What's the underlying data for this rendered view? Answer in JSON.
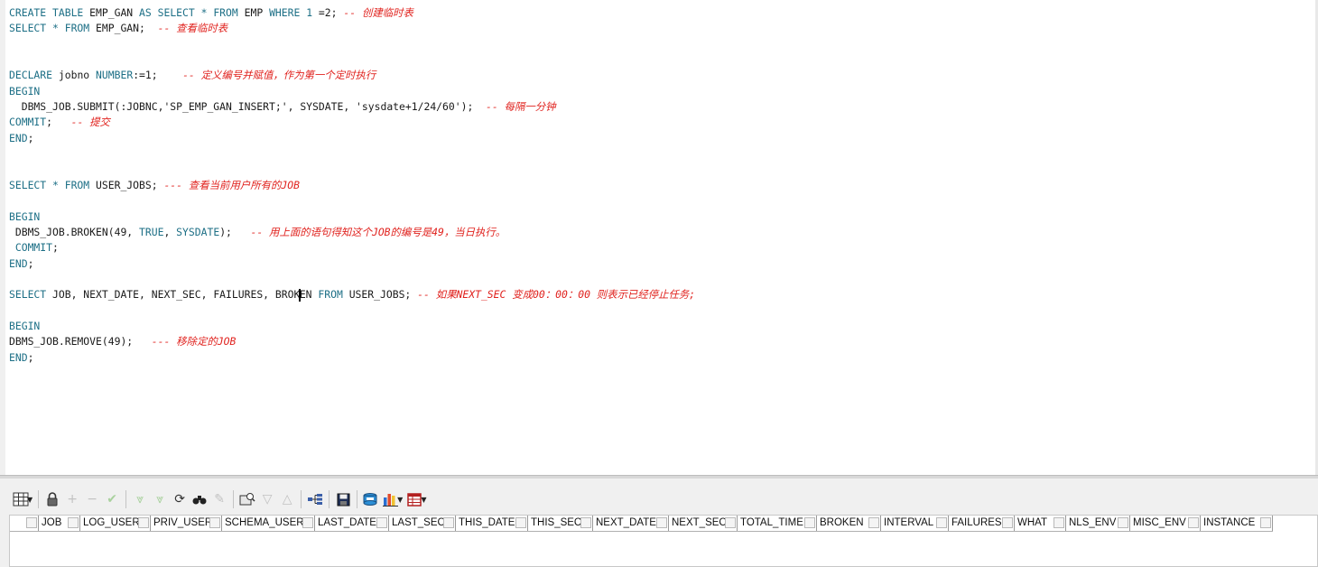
{
  "editor": {
    "lines": [
      {
        "segments": [
          {
            "t": "kw",
            "v": "CREATE TABLE "
          },
          {
            "t": "",
            "v": "EMP_GAN "
          },
          {
            "t": "kw",
            "v": "AS SELECT * FROM "
          },
          {
            "t": "",
            "v": "EMP "
          },
          {
            "t": "kw",
            "v": "WHERE "
          },
          {
            "t": "num",
            "v": "1"
          },
          {
            "t": "",
            "v": " =2; "
          },
          {
            "t": "cm",
            "v": "-- 创建临时表"
          }
        ]
      },
      {
        "segments": [
          {
            "t": "kw",
            "v": "SELECT * FROM "
          },
          {
            "t": "",
            "v": "EMP_GAN;  "
          },
          {
            "t": "cm",
            "v": "-- 查看临时表"
          }
        ]
      },
      {
        "segments": []
      },
      {
        "segments": []
      },
      {
        "segments": [
          {
            "t": "kw",
            "v": "DECLARE "
          },
          {
            "t": "",
            "v": "jobno "
          },
          {
            "t": "kw",
            "v": "NUMBER"
          },
          {
            "t": "",
            "v": ":=1;    "
          },
          {
            "t": "cm",
            "v": "-- 定义编号并赋值，作为第一个定时执行"
          }
        ]
      },
      {
        "segments": [
          {
            "t": "kw",
            "v": "BEGIN"
          }
        ]
      },
      {
        "segments": [
          {
            "t": "",
            "v": "  DBMS_JOB.SUBMIT(:JOBNC,'SP_EMP_GAN_INSERT;', SYSDATE, 'sysdate+1/24/60');  "
          },
          {
            "t": "cm",
            "v": "-- 每隔一分钟"
          }
        ]
      },
      {
        "segments": [
          {
            "t": "kw",
            "v": "COMMIT"
          },
          {
            "t": "",
            "v": ";   "
          },
          {
            "t": "cm",
            "v": "-- 提交"
          }
        ]
      },
      {
        "segments": [
          {
            "t": "kw",
            "v": "END"
          },
          {
            "t": "",
            "v": ";"
          }
        ]
      },
      {
        "segments": []
      },
      {
        "segments": []
      },
      {
        "segments": [
          {
            "t": "kw",
            "v": "SELECT * FROM "
          },
          {
            "t": "",
            "v": "USER_JOBS; "
          },
          {
            "t": "cm",
            "v": "--- 查看当前用户所有的JOB"
          }
        ]
      },
      {
        "segments": []
      },
      {
        "segments": [
          {
            "t": "kw",
            "v": "BEGIN"
          }
        ]
      },
      {
        "segments": [
          {
            "t": "",
            "v": " DBMS_JOB.BROKEN(49, "
          },
          {
            "t": "kw",
            "v": "TRUE"
          },
          {
            "t": "",
            "v": ", "
          },
          {
            "t": "kw",
            "v": "SYSDATE"
          },
          {
            "t": "",
            "v": ");   "
          },
          {
            "t": "cm",
            "v": "-- 用上面的语句得知这个JOB的编号是49，当日执行。"
          }
        ]
      },
      {
        "segments": [
          {
            "t": "kw",
            "v": " COMMIT"
          },
          {
            "t": "",
            "v": ";"
          }
        ]
      },
      {
        "segments": [
          {
            "t": "kw",
            "v": "END"
          },
          {
            "t": "",
            "v": ";"
          }
        ]
      },
      {
        "segments": []
      },
      {
        "segments": [
          {
            "t": "kw",
            "v": "SELECT "
          },
          {
            "t": "",
            "v": "JOB, NEXT_DATE, NEXT_SEC, FAILURES, BROK"
          },
          {
            "t": "cursor",
            "v": ""
          },
          {
            "t": "",
            "v": "EN "
          },
          {
            "t": "kw",
            "v": "FROM "
          },
          {
            "t": "",
            "v": "USER_JOBS; "
          },
          {
            "t": "cm",
            "v": "-- 如果NEXT_SEC 变成00：00：00 则表示已经停止任务;"
          }
        ]
      },
      {
        "segments": []
      },
      {
        "segments": [
          {
            "t": "kw",
            "v": "BEGIN"
          }
        ]
      },
      {
        "segments": [
          {
            "t": "",
            "v": "DBMS_JOB.REMOVE(49);   "
          },
          {
            "t": "cm",
            "v": "--- 移除定的JOB"
          }
        ]
      },
      {
        "segments": [
          {
            "t": "kw",
            "v": "END"
          },
          {
            "t": "",
            "v": ";"
          }
        ]
      }
    ]
  },
  "toolbar": {
    "icons": [
      "grid-view-icon",
      "lock-icon",
      "add-row-icon",
      "delete-row-icon",
      "post-changes-icon",
      "fetch-next-icon",
      "fetch-all-icon",
      "refresh-icon",
      "find-icon",
      "clear-icon",
      "query-by-example-icon",
      "next-record-icon",
      "previous-record-icon",
      "explain-plan-icon",
      "save-icon",
      "export-icon",
      "chart-icon",
      "single-record-view-icon"
    ]
  },
  "grid": {
    "columns": [
      "JOB",
      "LOG_USER",
      "PRIV_USER",
      "SCHEMA_USER",
      "LAST_DATE",
      "LAST_SEC",
      "THIS_DATE",
      "THIS_SEC",
      "NEXT_DATE",
      "NEXT_SEC",
      "TOTAL_TIME",
      "BROKEN",
      "INTERVAL",
      "FAILURES",
      "WHAT",
      "NLS_ENV",
      "MISC_ENV",
      "INSTANCE"
    ],
    "column_widths": [
      32,
      46,
      78,
      79,
      103,
      82,
      74,
      80,
      72,
      84,
      76,
      88,
      71,
      75,
      73,
      57,
      71,
      78,
      80
    ]
  },
  "colors": {
    "keyword": "#1d6f86",
    "comment": "#e0221e",
    "text": "#1a1a1a"
  }
}
